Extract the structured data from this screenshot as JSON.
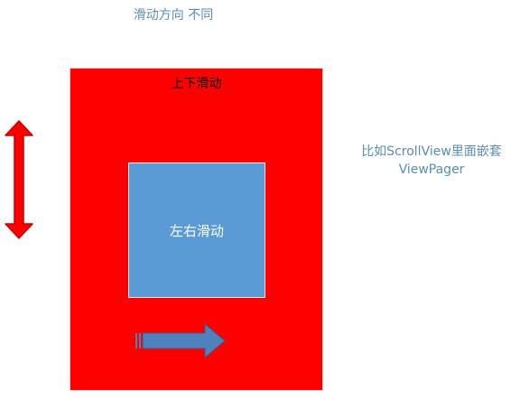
{
  "title": "滑动方向 不同",
  "outer_box": {
    "label": "上下滑动",
    "color": "#ff0000"
  },
  "inner_box": {
    "label": "左右滑动",
    "color": "#5b9bd5"
  },
  "note": {
    "line1": "比如ScrollView里面嵌套",
    "line2": "ViewPager"
  },
  "arrows": {
    "vertical": {
      "direction": "up-down",
      "color": "#ff0000"
    },
    "horizontal": {
      "direction": "right",
      "color": "#4f81bd"
    }
  }
}
